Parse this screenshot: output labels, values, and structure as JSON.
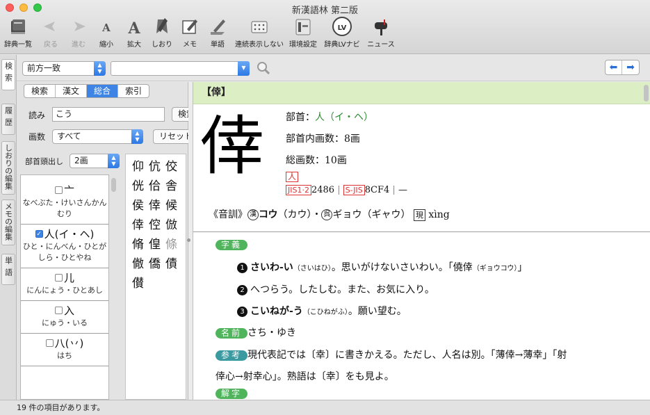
{
  "window": {
    "title": "新漢語林 第二版"
  },
  "toolbar": {
    "items": [
      {
        "label": "辞典一覧",
        "icon": "books-icon"
      },
      {
        "label": "戻る",
        "icon": "back-arrow-icon"
      },
      {
        "label": "進む",
        "icon": "forward-arrow-icon"
      },
      {
        "label": "縮小",
        "icon": "font-smaller-icon"
      },
      {
        "label": "拡大",
        "icon": "font-larger-icon"
      },
      {
        "label": "しおり",
        "icon": "bookmark-icon"
      },
      {
        "label": "メモ",
        "icon": "memo-icon"
      },
      {
        "label": "単語",
        "icon": "word-icon"
      },
      {
        "label": "連続表示しない",
        "icon": "continuous-display-icon"
      },
      {
        "label": "環境設定",
        "icon": "preferences-icon"
      },
      {
        "label": "辞典LVナビ",
        "icon": "lv-navi-icon"
      },
      {
        "label": "ニュース",
        "icon": "mailbox-icon"
      }
    ]
  },
  "side_tabs": [
    {
      "label": "検索"
    },
    {
      "label": "履歴"
    },
    {
      "label": "しおりの編集"
    },
    {
      "label": "メモの編集"
    },
    {
      "label": "単語"
    }
  ],
  "search": {
    "mode": "前方一致",
    "query": ""
  },
  "left": {
    "tabs": [
      "検索",
      "漢文",
      "総合",
      "索引"
    ],
    "active_tab": "総合",
    "reading_label": "読み",
    "reading_value": "こう",
    "search_button": "検索",
    "strokes_label": "画数",
    "strokes_value": "すべて",
    "reset_button": "リセット",
    "radical_label": "部首頭出し",
    "radical_strokes": "2画",
    "radicals": [
      {
        "char": "亠",
        "reading": "なべぶた・けいさんかんむり",
        "checked": false
      },
      {
        "char": "人(イ・ヘ)",
        "reading": "ひと・にんべん・ひとがしら・ひとやね",
        "checked": true
      },
      {
        "char": "儿",
        "reading": "にんにょう・ひとあし",
        "checked": false
      },
      {
        "char": "入",
        "reading": "にゅう・いる",
        "checked": false
      },
      {
        "char": "八(丷)",
        "reading": "はち",
        "checked": false
      }
    ],
    "kanji_results": [
      "仰",
      "伉",
      "佼",
      "侊",
      "佮",
      "舎",
      "侯",
      "倖",
      "候",
      "倖",
      "倥",
      "倣",
      "脩",
      "偟",
      "條",
      "僘",
      "僑",
      "債",
      "儧"
    ]
  },
  "entry": {
    "header": "【倖】",
    "kanji": "倖",
    "radical_label": "部首：",
    "radical_value": "人（イ・ヘ）",
    "inner_strokes": "部首内画数：8画",
    "total_strokes": "総画数：10画",
    "name_mark": "人",
    "jis_label": "JIS1·2",
    "jis_value": "2486",
    "sjis_label": "S-JIS",
    "sjis_value": "8CF4",
    "code_dash": "—",
    "onkun_label": "《音訓》",
    "kan_mark": "漢",
    "reading_kan": "コウ",
    "reading_kan_alt": "（カウ）・",
    "go_mark": "呉",
    "reading_go": "ギョウ（ギャウ）",
    "pinyin_mark": "現",
    "pinyin": "xìng",
    "section_meaning": "字義",
    "meanings": [
      {
        "num": "1",
        "head": "さいわ-い",
        "ruby": "（さいはひ）",
        "text": "。思いがけないさいわい。「僥倖",
        "ruby2": "（ギョウコウ）",
        "tail": "」"
      },
      {
        "num": "2",
        "head": "",
        "ruby": "",
        "text": "へつらう。したしむ。また、お気に入り。",
        "ruby2": "",
        "tail": ""
      },
      {
        "num": "3",
        "head": "こいねが-う",
        "ruby": "（こひねがふ）",
        "text": "。願い望む。",
        "ruby2": "",
        "tail": ""
      }
    ],
    "section_name": "名前",
    "name_text": "さち・ゆき",
    "section_ref": "参考",
    "ref_text_1": "現代表記では〔幸〕に書きかえる。ただし、人名は別。「薄倖→薄幸」「射",
    "ref_text_2": "倖心→射幸心」。熟語は〔幸〕をも見よ。",
    "section_explain": "解字"
  },
  "status": {
    "text": "19 件の項目があります。"
  },
  "colors": {
    "header_bg": "#dcefc4",
    "badge_green": "#4fb45c",
    "badge_teal": "#3a9aa0",
    "accent_blue": "#3d84e4"
  }
}
